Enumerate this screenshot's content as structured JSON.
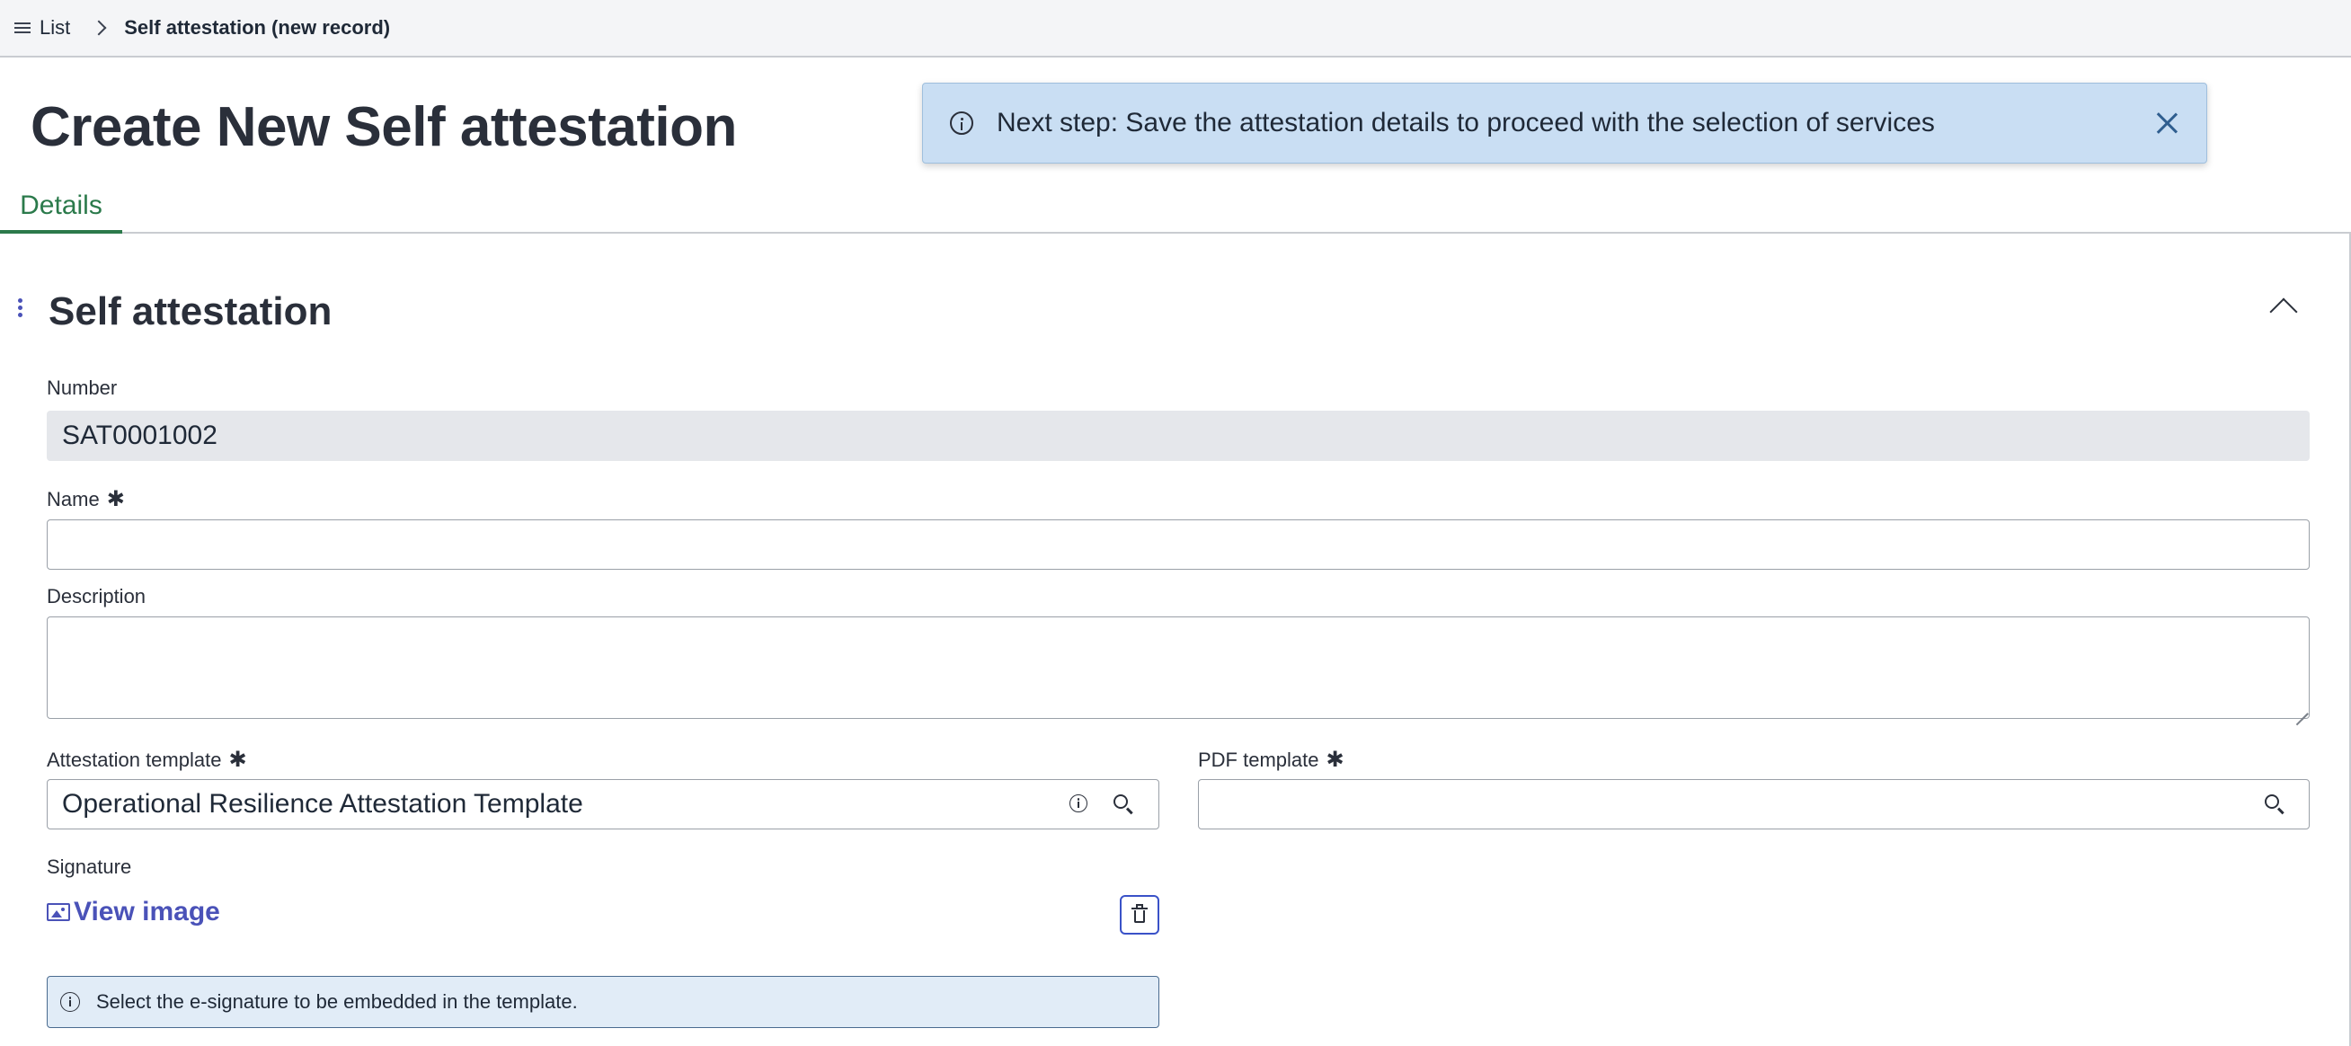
{
  "breadcrumb": {
    "list_label": "List",
    "current": "Self attestation (new record)"
  },
  "page_title": "Create New Self attestation",
  "notification": {
    "text": "Next step: Save the attestation details to proceed with the selection of services"
  },
  "tabs": [
    {
      "label": "Details",
      "active": true
    }
  ],
  "section": {
    "title": "Self attestation"
  },
  "form": {
    "number": {
      "label": "Number",
      "value": "SAT0001002"
    },
    "name": {
      "label": "Name",
      "required": true,
      "value": ""
    },
    "description": {
      "label": "Description",
      "value": ""
    },
    "attestation_template": {
      "label": "Attestation template",
      "required": true,
      "value": "Operational Resilience Attestation Template"
    },
    "pdf_template": {
      "label": "PDF template",
      "required": true,
      "value": ""
    },
    "signature": {
      "label": "Signature",
      "view_image_label": "View image"
    },
    "signature_hint": "Select the e-signature to be embedded in the template.",
    "required_marker": "✱"
  },
  "colors": {
    "accent_green": "#2b7a4b",
    "link_blue": "#4a52b8",
    "toast_bg": "#c9def3",
    "hint_bg": "#e1ecf7"
  }
}
